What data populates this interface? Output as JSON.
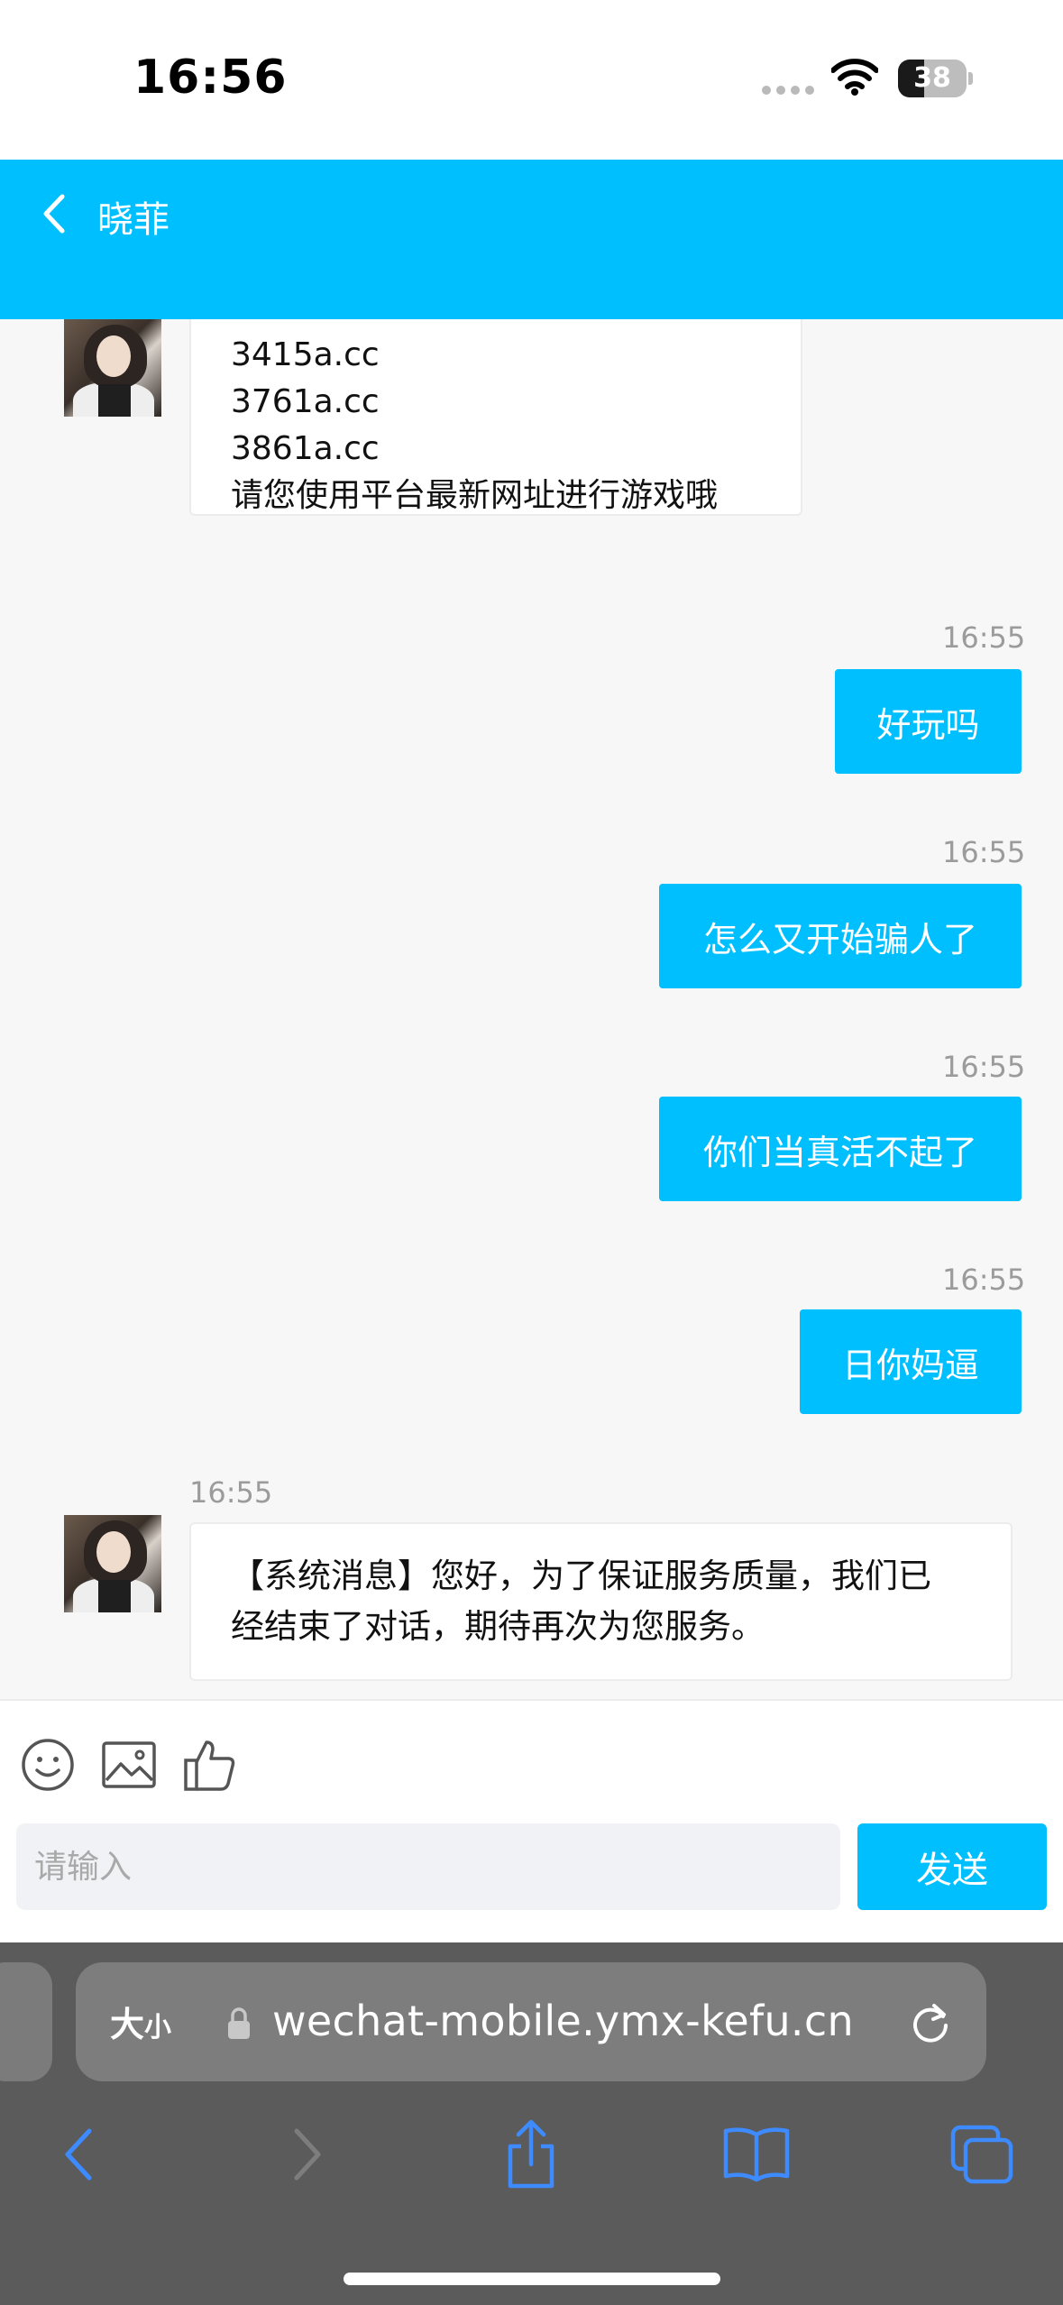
{
  "status_bar": {
    "time": "16:56",
    "battery": "38",
    "battery_level": 0.38
  },
  "header": {
    "title": "晓菲"
  },
  "messages": [
    {
      "side": "left",
      "lines": [
        "3415a.cc",
        "3761a.cc",
        "3861a.cc",
        "请您使用平台最新网址进行游戏哦"
      ]
    },
    {
      "side": "right",
      "time": "16:55",
      "text": "好玩吗"
    },
    {
      "side": "right",
      "time": "16:55",
      "text": "怎么又开始骗人了"
    },
    {
      "side": "right",
      "time": "16:55",
      "text": "你们当真活不起了"
    },
    {
      "side": "right",
      "time": "16:55",
      "text": "日你妈逼"
    },
    {
      "side": "left",
      "time": "16:55",
      "lines": [
        "【系统消息】您好，为了保证服务质量，我们已",
        "经结束了对话，期待再次为您服务。"
      ]
    }
  ],
  "composer": {
    "placeholder": "请输入",
    "send_label": "发送",
    "tools": [
      "emoji-icon",
      "image-icon",
      "thumbs-up-icon"
    ]
  },
  "browser": {
    "aa_big": "大",
    "aa_small": "小",
    "url": "wechat-mobile.ymx-kefu.cn"
  },
  "colors": {
    "accent": "#00bfff",
    "background": "#f7f7f8",
    "browser_bar": "#5b5b5b",
    "ios_blue": "#3d8bff"
  }
}
